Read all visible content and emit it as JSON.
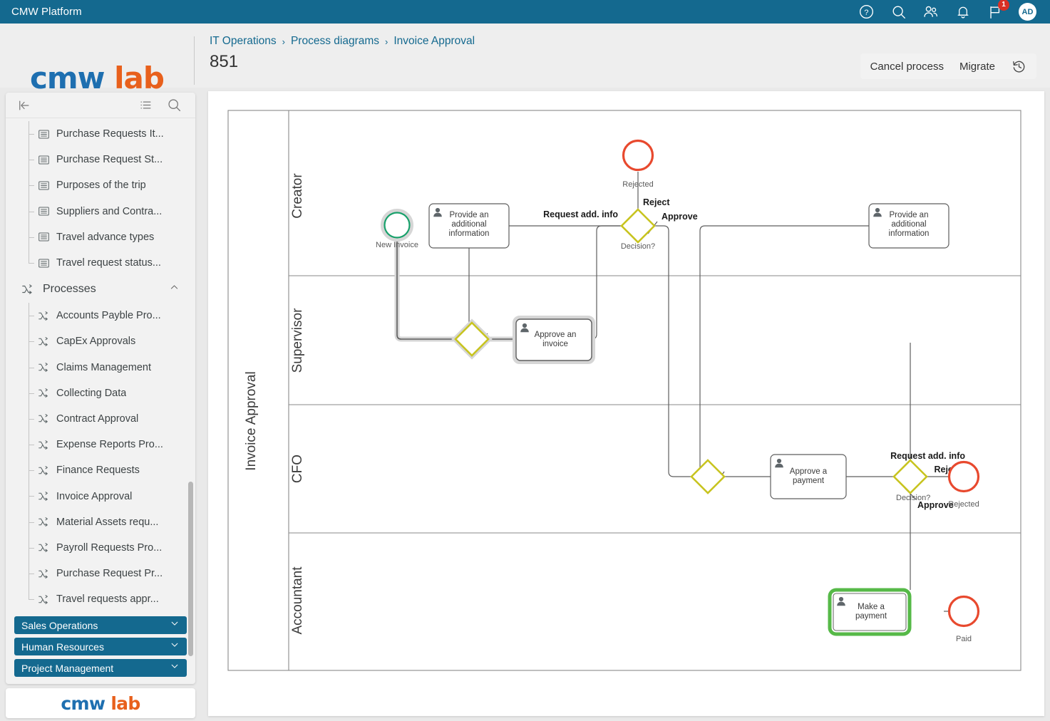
{
  "topbar": {
    "title": "CMW Platform",
    "icons": [
      {
        "name": "help-icon",
        "glyph": "?"
      },
      {
        "name": "search-icon",
        "glyph": "search"
      },
      {
        "name": "users-icon",
        "glyph": "users"
      },
      {
        "name": "bell-icon",
        "glyph": "bell"
      },
      {
        "name": "flag-icon",
        "glyph": "flag",
        "badge": "1"
      }
    ],
    "avatar_initials": "AD",
    "bg_color": "#14698f"
  },
  "brand": {
    "cmw": "cmw",
    "lab": "lab",
    "cmw_color": "#1e6fb0",
    "lab_color": "#e8601c"
  },
  "breadcrumb": {
    "items": [
      "IT Operations",
      "Process diagrams",
      "Invoice Approval"
    ],
    "separator": "›",
    "process_id": "851"
  },
  "header_actions": {
    "cancel_label": "Cancel process",
    "migrate_label": "Migrate",
    "history_icon": "history-icon"
  },
  "sidebar": {
    "toolbar": {
      "collapse_icon": "collapse-left-icon",
      "list_icon": "list-icon",
      "search_icon": "search-icon"
    },
    "top_items": [
      {
        "label": "Purchase Requests It...",
        "icon": "table-icon"
      },
      {
        "label": "Purchase Request St...",
        "icon": "table-icon"
      },
      {
        "label": "Purposes of the trip",
        "icon": "table-icon"
      },
      {
        "label": "Suppliers and Contra...",
        "icon": "table-icon"
      },
      {
        "label": "Travel advance types",
        "icon": "table-icon"
      },
      {
        "label": "Travel request status...",
        "icon": "table-icon"
      }
    ],
    "group": {
      "label": "Processes",
      "icon": "process-icon",
      "chevron": "chevron-up-icon"
    },
    "process_items": [
      {
        "label": "Accounts Payble Pro...",
        "icon": "process-icon"
      },
      {
        "label": "CapEx Approvals",
        "icon": "process-icon"
      },
      {
        "label": "Claims Management",
        "icon": "process-icon"
      },
      {
        "label": "Collecting Data",
        "icon": "process-icon"
      },
      {
        "label": "Contract Approval",
        "icon": "process-icon"
      },
      {
        "label": "Expense Reports Pro...",
        "icon": "process-icon"
      },
      {
        "label": "Finance Requests",
        "icon": "process-icon"
      },
      {
        "label": "Invoice Approval",
        "icon": "process-icon"
      },
      {
        "label": "Material Assets requ...",
        "icon": "process-icon"
      },
      {
        "label": "Payroll Requests Pro...",
        "icon": "process-icon"
      },
      {
        "label": "Purchase Request Pr...",
        "icon": "process-icon"
      },
      {
        "label": "Travel requests appr...",
        "icon": "process-icon"
      }
    ],
    "blue_sections": [
      {
        "label": "Sales Operations",
        "chevron": "chevron-down-icon"
      },
      {
        "label": "Human Resources",
        "chevron": "chevron-down-icon"
      },
      {
        "label": "Project Management",
        "chevron": "chevron-down-icon"
      }
    ],
    "footer_logo": {
      "cmw": "cmw",
      "lab": "lab"
    }
  },
  "diagram": {
    "pool_title": "Invoice Approval",
    "lanes": [
      "Creator",
      "Supervisor",
      "CFO",
      "Accountant"
    ],
    "nodes": [
      {
        "id": "start",
        "type": "start-event",
        "label": "New Invoice",
        "lane": "Creator",
        "color": "#17a06a",
        "highlighted": true
      },
      {
        "id": "provide1",
        "type": "user-task",
        "label": "Provide an additional information",
        "lane": "Creator"
      },
      {
        "id": "rejected1",
        "type": "end-event",
        "label": "Rejected",
        "lane": "Creator",
        "color": "#e8492e"
      },
      {
        "id": "decision1",
        "type": "gateway",
        "label": "Decision?",
        "lane": "Creator",
        "color": "#c8c420"
      },
      {
        "id": "provide2",
        "type": "user-task",
        "label": "Provide an additional information",
        "lane": "Creator"
      },
      {
        "id": "gw-sup",
        "type": "gateway",
        "label": "",
        "lane": "Supervisor",
        "color": "#c8c420",
        "highlighted": true
      },
      {
        "id": "approve-invoice",
        "type": "user-task",
        "label": "Approve an invoice",
        "lane": "Supervisor",
        "highlighted": true
      },
      {
        "id": "gw-cfo",
        "type": "gateway",
        "label": "",
        "lane": "CFO",
        "color": "#c8c420"
      },
      {
        "id": "approve-payment",
        "type": "user-task",
        "label": "Approve a payment",
        "lane": "CFO"
      },
      {
        "id": "decision2",
        "type": "gateway",
        "label": "Decision?",
        "lane": "CFO",
        "color": "#c8c420"
      },
      {
        "id": "rejected2",
        "type": "end-event",
        "label": "Rejected",
        "lane": "CFO",
        "color": "#e8492e"
      },
      {
        "id": "make-payment",
        "type": "user-task",
        "label": "Make a payment",
        "lane": "Accountant",
        "active": true,
        "border_color": "#56b948"
      },
      {
        "id": "paid",
        "type": "end-event",
        "label": "Paid",
        "lane": "Accountant",
        "color": "#e8492e"
      }
    ],
    "flow_labels": [
      {
        "text": "Request add. info",
        "at": "decision1-left"
      },
      {
        "text": "Reject",
        "at": "decision1-top"
      },
      {
        "text": "Approve",
        "at": "decision1-right"
      },
      {
        "text": "Request add. info",
        "at": "decision2-top"
      },
      {
        "text": "Reject",
        "at": "decision2-right"
      },
      {
        "text": "Approve",
        "at": "decision2-bottom"
      }
    ]
  }
}
